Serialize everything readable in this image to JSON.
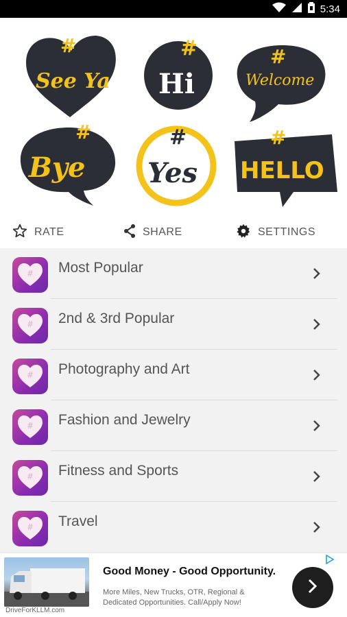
{
  "status_bar": {
    "time": "5:34"
  },
  "stickers": {
    "see_ya": "See Ya",
    "hi": "Hi",
    "welcome": "Welcome",
    "bye": "Bye",
    "yes": "Yes",
    "hello": "HELLO",
    "hash": "#"
  },
  "actions": {
    "rate": "RATE",
    "share": "SHARE",
    "settings": "SETTINGS"
  },
  "categories": [
    {
      "label": "Most Popular"
    },
    {
      "label": "2nd & 3rd Popular"
    },
    {
      "label": "Photography and Art"
    },
    {
      "label": "Fashion and Jewelry"
    },
    {
      "label": "Fitness and Sports"
    },
    {
      "label": "Travel"
    }
  ],
  "ad": {
    "headline": "Good Money - Good Opportunity.",
    "body": "More Miles, New Trucks, OTR, Regional & Dedicated Opportunities. Call/Apply Now!",
    "source": "DriveForKLLM.com"
  },
  "colors": {
    "sticker_dark": "#2b2e35",
    "sticker_yellow": "#f3c21b",
    "icon_gradient_start": "#c44a9a",
    "icon_gradient_end": "#6a2aa8"
  }
}
